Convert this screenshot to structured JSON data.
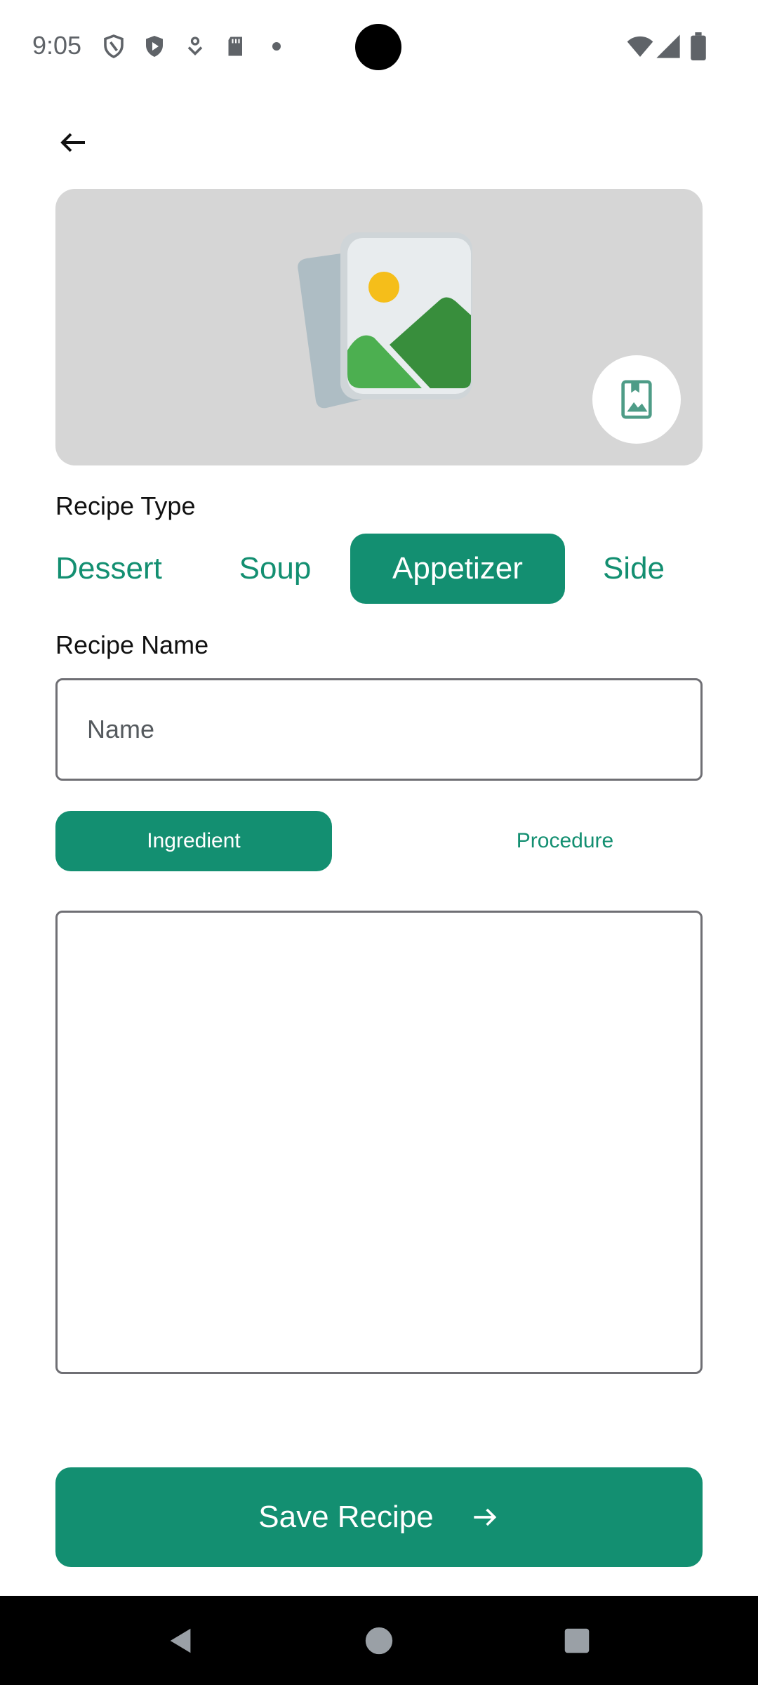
{
  "status_bar": {
    "time": "9:05",
    "icons": [
      "shield-icon",
      "play-protect-icon",
      "download-icon",
      "sd-card-icon",
      "dot-icon",
      "wifi-icon",
      "signal-icon",
      "battery-icon"
    ]
  },
  "header": {
    "back_icon": "arrow-left-icon"
  },
  "image_card": {
    "illustration": "image-placeholder-icon",
    "action_icon": "gallery-icon"
  },
  "recipe_type": {
    "label": "Recipe Type",
    "options": [
      "Dessert",
      "Soup",
      "Appetizer",
      "Side"
    ],
    "selected": "Appetizer"
  },
  "recipe_name": {
    "label": "Recipe Name",
    "placeholder": "Name",
    "value": ""
  },
  "tabs": {
    "items": [
      "Ingredient",
      "Procedure"
    ],
    "active": "Ingredient"
  },
  "content": {
    "value": ""
  },
  "save_button": {
    "label": "Save Recipe",
    "icon": "arrow-right-icon"
  },
  "nav_bar": {
    "icons": [
      "back-triangle-icon",
      "home-circle-icon",
      "recents-square-icon"
    ]
  },
  "colors": {
    "accent": "#138f71",
    "card_bg": "#d6d6d6",
    "border": "#6f6f74"
  }
}
